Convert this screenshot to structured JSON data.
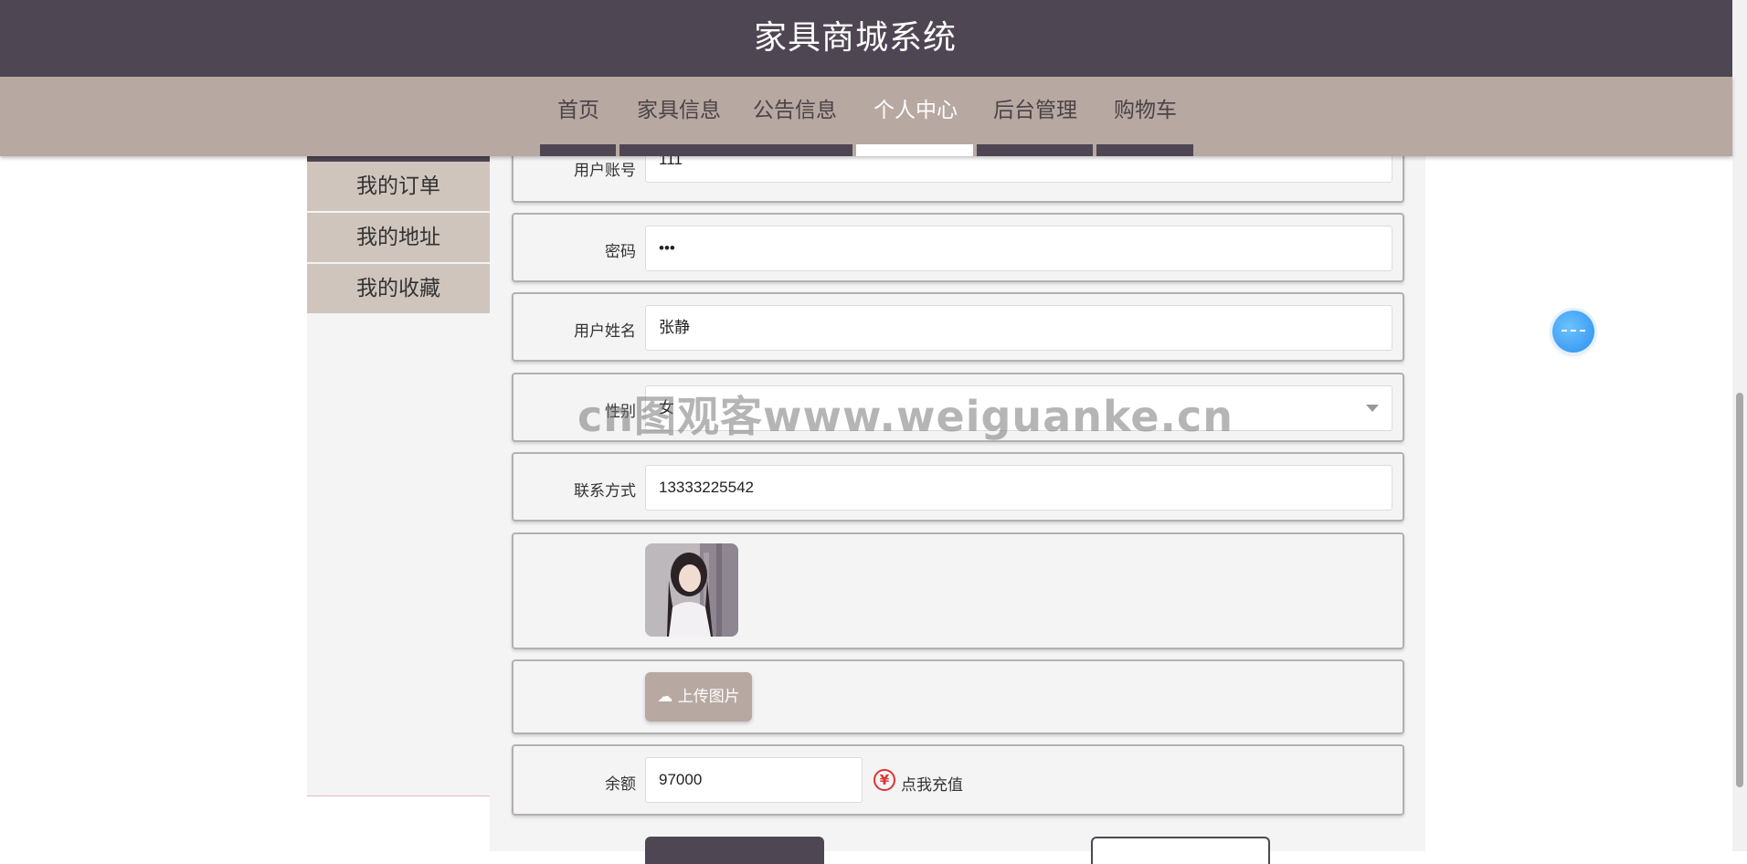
{
  "header": {
    "title": "家具商城系统"
  },
  "nav": {
    "items": [
      {
        "label": "首页"
      },
      {
        "label": "家具信息"
      },
      {
        "label": "公告信息"
      },
      {
        "label": "个人中心"
      },
      {
        "label": "后台管理"
      },
      {
        "label": "购物车"
      }
    ],
    "active": "个人中心"
  },
  "sidebar": {
    "items": [
      {
        "label": "我的订单"
      },
      {
        "label": "我的地址"
      },
      {
        "label": "我的收藏"
      }
    ]
  },
  "form": {
    "account": {
      "label": "用户账号",
      "value": "111"
    },
    "password": {
      "label": "密码",
      "value": "•••"
    },
    "name": {
      "label": "用户姓名",
      "value": "张静"
    },
    "gender": {
      "label": "性别",
      "value": "女"
    },
    "phone": {
      "label": "联系方式",
      "value": "13333225542"
    },
    "upload": {
      "label": "上传图片",
      "icon": "cloud-upload-icon"
    },
    "balance": {
      "label": "余额",
      "value": "97000",
      "recharge_label": "点我充值",
      "recharge_icon": "¥"
    }
  },
  "watermark": "cn图观客www.weiguanke.cn",
  "colors": {
    "header": "#4f4653",
    "nav": "#b7a8a1",
    "sidebar_item": "#cfc5bd",
    "accent_blue": "#2b8ef0",
    "recharge_red": "#dd3333"
  }
}
